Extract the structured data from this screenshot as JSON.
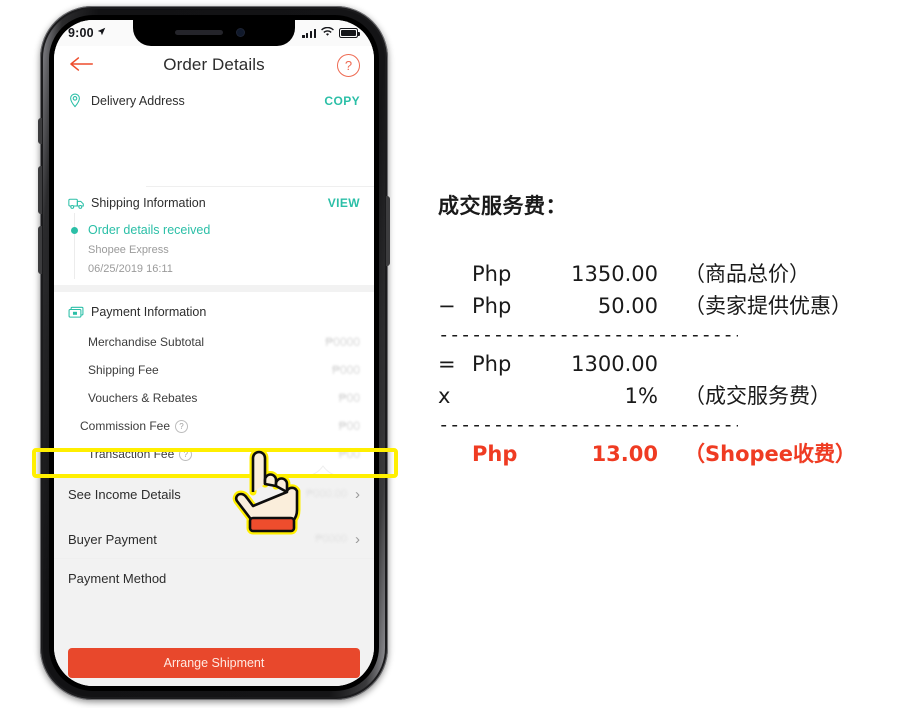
{
  "phone": {
    "status_bar": {
      "time": "9:00",
      "location_arrow": "➢",
      "signal_icon": "cellular-signal-icon",
      "wifi_icon": "wifi-icon",
      "battery_icon": "battery-icon"
    },
    "nav": {
      "back_icon": "←",
      "title": "Order Details",
      "help_icon": "?"
    },
    "delivery": {
      "pin_icon": "location-pin-icon",
      "label": "Delivery Address",
      "action": "COPY"
    },
    "shipping": {
      "truck_icon": "delivery-truck-icon",
      "label": "Shipping Information",
      "action": "VIEW",
      "status": "Order details received",
      "courier": "Shopee Express",
      "timestamp": "06/25/2019 16:11"
    },
    "payment": {
      "money_icon": "banknote-icon",
      "label": "Payment Information",
      "fees": [
        {
          "label": "Merchandise Subtotal",
          "has_info": false
        },
        {
          "label": "Shipping Fee",
          "has_info": false
        },
        {
          "label": "Vouchers & Rebates",
          "has_info": false
        },
        {
          "label": "Commission Fee",
          "has_info": true
        },
        {
          "label": "Transaction Fee",
          "has_info": true
        }
      ],
      "info_icon": "?"
    },
    "list_rows": [
      {
        "label": "See Income Details",
        "chevron": "›"
      },
      {
        "label": "Buyer Payment",
        "chevron": "›"
      },
      {
        "label": "Payment Method",
        "chevron": ""
      }
    ],
    "cta": {
      "label": "Arrange Shipment"
    }
  },
  "annotation": {
    "highlight_target": "Commission Fee",
    "highlight_color": "#FFEF00",
    "cursor_icon": "pointing-hand-cursor"
  },
  "calculation": {
    "title": "成交服务费：",
    "rows": [
      {
        "op": "",
        "currency": "Php",
        "amount": "1350.00",
        "note": "（商品总价）",
        "is_total": false
      },
      {
        "op": "−",
        "currency": "Php",
        "amount": "50.00",
        "note": "（卖家提供优惠）",
        "is_total": false
      }
    ],
    "rule1": "------------------------------------",
    "rows2": [
      {
        "op": "=",
        "currency": "Php",
        "amount": "1300.00",
        "note": "",
        "is_total": false
      },
      {
        "op": "x",
        "currency": "",
        "amount": "1%",
        "note": "（成交服务费）",
        "is_total": false
      }
    ],
    "rule2": "------------------------------------",
    "total": {
      "op": "",
      "currency": "Php",
      "amount": "13.00",
      "note": "（Shopee收费）",
      "is_total": true
    },
    "total_color": "#EF3B22"
  },
  "theme": {
    "shopee_orange": "#E8482C",
    "teal": "#2BBFA7",
    "highlight_yellow": "#FFEF00",
    "red_text": "#EF3B22"
  }
}
